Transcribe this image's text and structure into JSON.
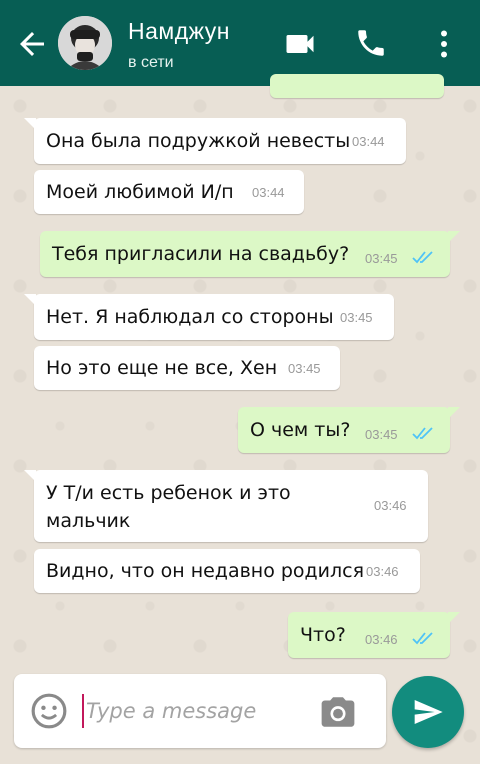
{
  "header": {
    "contact_name": "Намджун",
    "status": "в сети"
  },
  "colors": {
    "header": "#075e54",
    "outgoing_bubble": "#dcf8c6",
    "incoming_bubble": "#ffffff",
    "read_ticks": "#4fc3f7",
    "send_button": "#128c7e"
  },
  "icons": {
    "back": "arrow-back-icon",
    "video": "videocam-icon",
    "call": "phone-icon",
    "menu": "more-vert-icon",
    "emoji": "emoji-icon",
    "camera": "camera-icon",
    "send": "send-icon"
  },
  "messages": [
    {
      "direction": "in",
      "text": "Она была подружкой невесты",
      "time": "03:44"
    },
    {
      "direction": "in",
      "text": "Моей любимой И/п",
      "time": "03:44"
    },
    {
      "direction": "out",
      "text": "Тебя пригласили на свадьбу?",
      "time": "03:45",
      "status": "read"
    },
    {
      "direction": "in",
      "text": "Нет. Я наблюдал со стороны",
      "time": "03:45"
    },
    {
      "direction": "in",
      "text": "Но это еще не все, Хен",
      "time": "03:45"
    },
    {
      "direction": "out",
      "text": "О чем ты?",
      "time": "03:45",
      "status": "read"
    },
    {
      "direction": "in",
      "text_line1": "У Т/и есть ребенок и это",
      "text_line2": "мальчик",
      "time": "03:46"
    },
    {
      "direction": "in",
      "text": "Видно, что он недавно родился",
      "time": "03:46"
    },
    {
      "direction": "out",
      "text": "Что?",
      "time": "03:46",
      "status": "read"
    }
  ],
  "composer": {
    "placeholder": "Type a message",
    "value": ""
  }
}
